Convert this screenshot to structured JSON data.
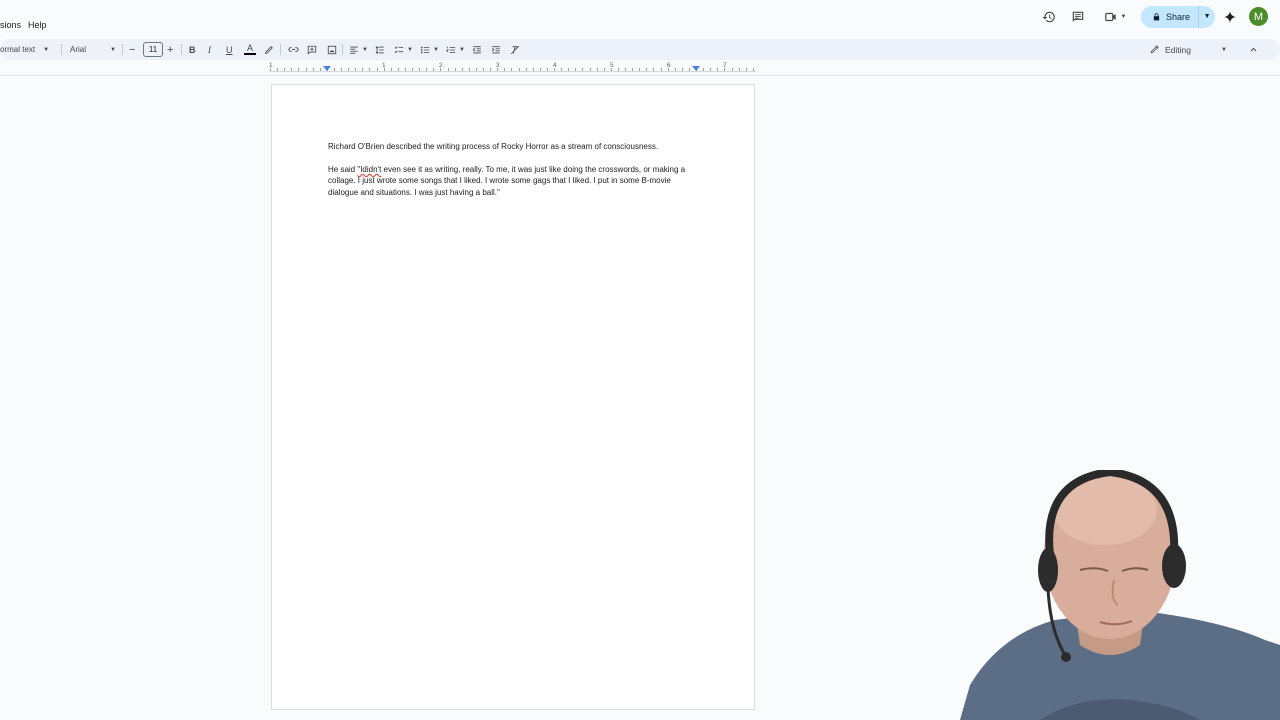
{
  "menu": {
    "items": [
      "sions",
      "Help"
    ]
  },
  "top_actions": {
    "icons": [
      "history-icon",
      "comment-icon",
      "video-call-icon",
      "gemini-star-icon"
    ],
    "share_label": "Share",
    "avatar_letter": "M"
  },
  "toolbar": {
    "style": "ormal text",
    "font": "Arial",
    "font_size": "11",
    "mode": "Editing",
    "colors": {
      "bar": "#edf2fa",
      "share": "#c2e7ff",
      "avatar": "#4c8c2b"
    }
  },
  "ruler": {
    "labels": [
      "1",
      "1",
      "2",
      "3",
      "4",
      "5",
      "6",
      "7"
    ]
  },
  "document": {
    "para1": "Richard O'Brien described the writing process of Rocky Horror as a stream of consciousness.",
    "para2_prefix": "He said ",
    "para2_misspelled": "\"Ididn't",
    "para2_rest": " even see it as writing, really. To me, it was just like doing the crosswords, or making a collage. I just wrote some songs that I liked. I wrote some gags that I liked. I put in some B-movie dialogue and situations. I was just having a ball.\""
  }
}
